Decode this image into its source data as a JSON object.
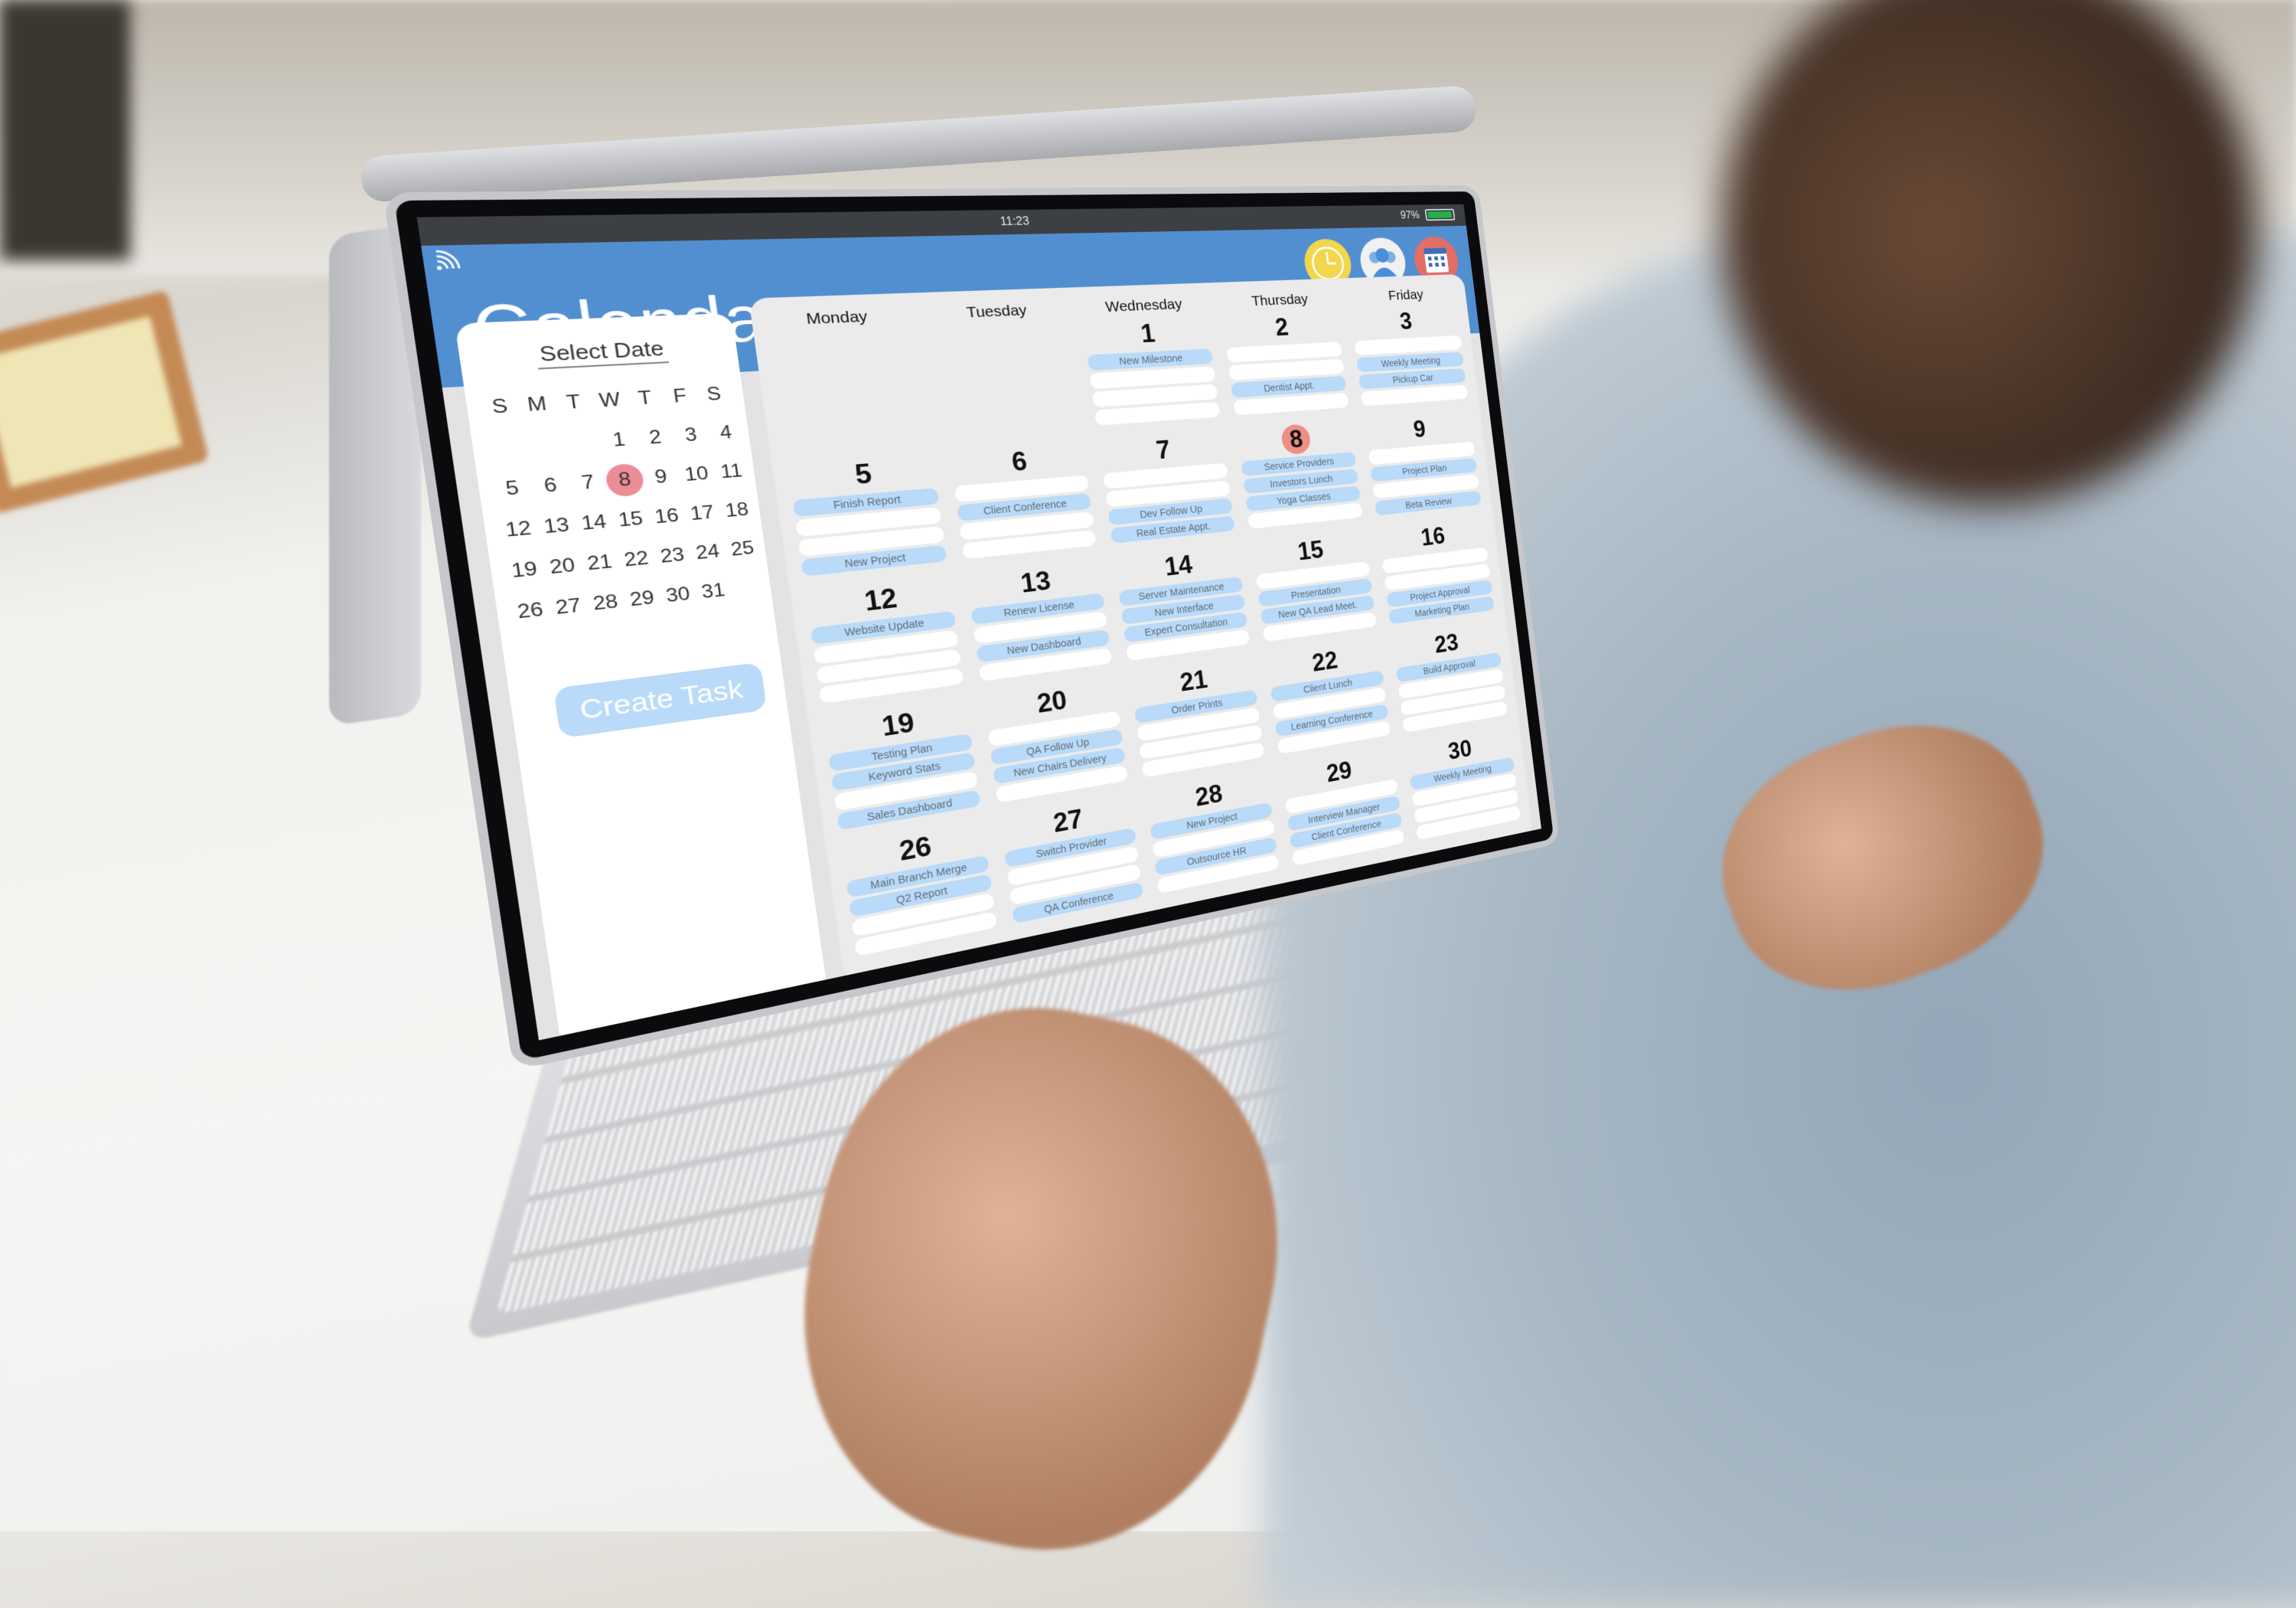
{
  "status_bar": {
    "time": "11:23",
    "battery_percent": "97%",
    "battery_level": 0.97,
    "wifi_icon": "wifi-icon"
  },
  "header": {
    "title": "Calendar",
    "icons": [
      {
        "name": "clock-icon",
        "color": "#f2d64c"
      },
      {
        "name": "people-icon",
        "color": "#f1f1f1"
      },
      {
        "name": "calendar-icon",
        "color": "#e36d67"
      }
    ],
    "color": "#528fd0"
  },
  "mini_calendar": {
    "title": "Select Date",
    "weekdays": [
      "S",
      "M",
      "T",
      "W",
      "T",
      "F",
      "S"
    ],
    "weeks": [
      [
        "",
        "",
        "",
        "1",
        "2",
        "3",
        "4"
      ],
      [
        "5",
        "6",
        "7",
        "8",
        "9",
        "10",
        "11"
      ],
      [
        "12",
        "13",
        "14",
        "15",
        "16",
        "17",
        "18"
      ],
      [
        "19",
        "20",
        "21",
        "22",
        "23",
        "24",
        "25"
      ],
      [
        "26",
        "27",
        "28",
        "29",
        "30",
        "31",
        ""
      ]
    ],
    "selected": "8",
    "selected_color": "#ec8c94",
    "create_task_label": "Create Task"
  },
  "week_view": {
    "weekdays": [
      "Monday",
      "Tuesday",
      "Wednesday",
      "Thursday",
      "Friday"
    ],
    "today": "8",
    "today_color": "#ee8e84",
    "event_color": "#b9daf8",
    "weeks": [
      [
        {
          "day": "",
          "slots": []
        },
        {
          "day": "",
          "slots": []
        },
        {
          "day": "1",
          "slots": [
            "New Milestone",
            "",
            "",
            ""
          ]
        },
        {
          "day": "2",
          "slots": [
            "",
            "",
            "Dentist Appt.",
            ""
          ]
        },
        {
          "day": "3",
          "slots": [
            "",
            "Weekly Meeting",
            "Pickup Car",
            ""
          ]
        }
      ],
      [
        {
          "day": "5",
          "slots": [
            "Finish Report",
            "",
            "",
            "New Project"
          ]
        },
        {
          "day": "6",
          "slots": [
            "",
            "Client Conference",
            "",
            ""
          ]
        },
        {
          "day": "7",
          "slots": [
            "",
            "",
            "Dev Follow Up",
            "Real Estate Appt."
          ]
        },
        {
          "day": "8",
          "slots": [
            "Service Providers",
            "Investors Lunch",
            "Yoga Classes",
            ""
          ]
        },
        {
          "day": "9",
          "slots": [
            "",
            "Project Plan",
            "",
            "Beta Review"
          ]
        }
      ],
      [
        {
          "day": "12",
          "slots": [
            "Website Update",
            "",
            "",
            ""
          ]
        },
        {
          "day": "13",
          "slots": [
            "Renew License",
            "",
            "New Dashboard",
            ""
          ]
        },
        {
          "day": "14",
          "slots": [
            "Server Maintenance",
            "New Interface",
            "Expert Consultation",
            ""
          ]
        },
        {
          "day": "15",
          "slots": [
            "",
            "Presentation",
            "New QA Lead Meet.",
            ""
          ]
        },
        {
          "day": "16",
          "slots": [
            "",
            "",
            "Project Approval",
            "Marketing Plan"
          ]
        }
      ],
      [
        {
          "day": "19",
          "slots": [
            "Testing Plan",
            "Keyword Stats",
            "",
            "Sales Dashboard"
          ]
        },
        {
          "day": "20",
          "slots": [
            "",
            "QA Follow Up",
            "New Chairs Delivery",
            ""
          ]
        },
        {
          "day": "21",
          "slots": [
            "Order Prints",
            "",
            "",
            ""
          ]
        },
        {
          "day": "22",
          "slots": [
            "Client Lunch",
            "",
            "Learning Conference",
            ""
          ]
        },
        {
          "day": "23",
          "slots": [
            "Build Approval",
            "",
            "",
            ""
          ]
        }
      ],
      [
        {
          "day": "26",
          "slots": [
            "Main Branch Merge",
            "Q2 Report",
            "",
            ""
          ]
        },
        {
          "day": "27",
          "slots": [
            "Switch Provider",
            "",
            "",
            "QA Conference"
          ]
        },
        {
          "day": "28",
          "slots": [
            "New Project",
            "",
            "Outsource HR",
            ""
          ]
        },
        {
          "day": "29",
          "slots": [
            "",
            "Interview Manager",
            "Client Conference",
            ""
          ]
        },
        {
          "day": "30",
          "slots": [
            "Weekly Meeting",
            "",
            "",
            ""
          ]
        }
      ]
    ]
  }
}
